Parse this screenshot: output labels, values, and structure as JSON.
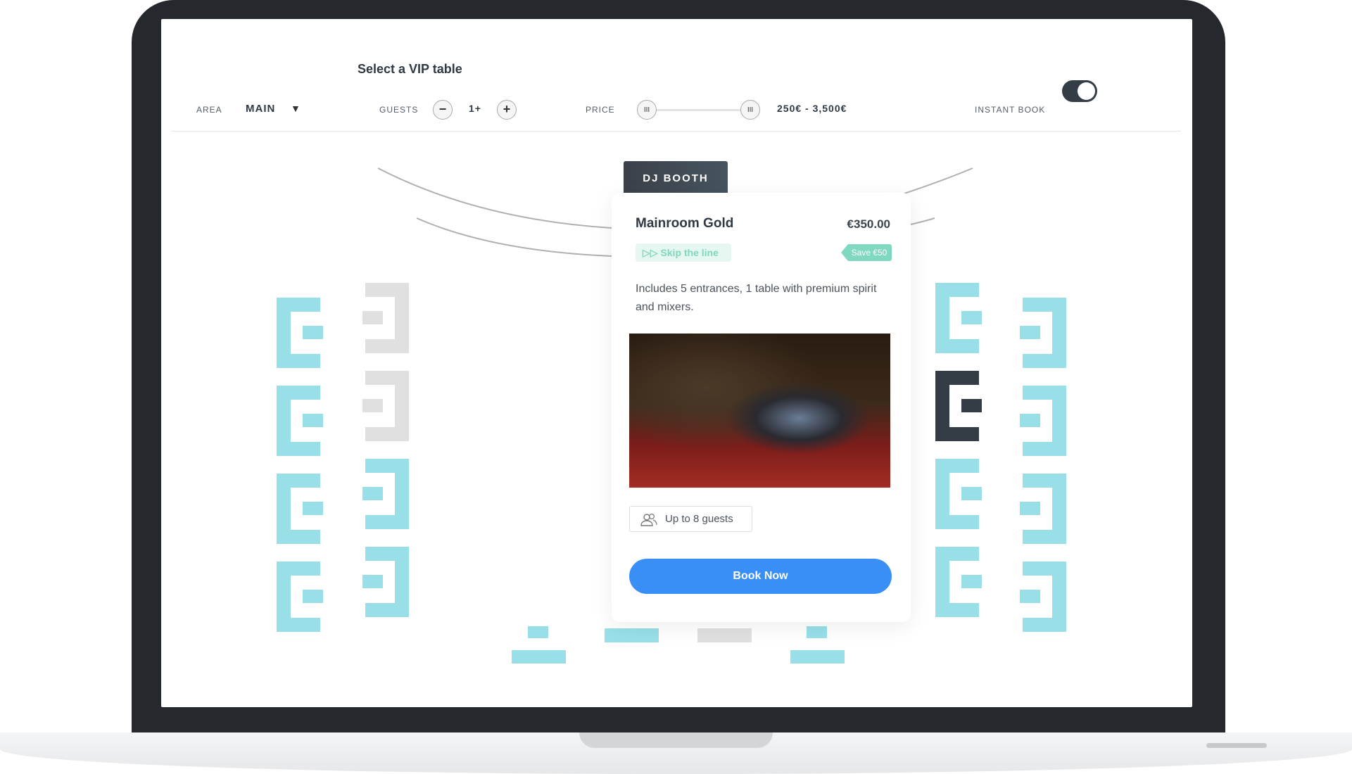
{
  "header": {
    "title": "Select a VIP table"
  },
  "filters": {
    "area_label": "AREA",
    "area_value": "MAIN",
    "guests_label": "GUESTS",
    "guests_value": "1+",
    "minus": "−",
    "plus": "+",
    "price_label": "PRICE",
    "price_range": "250€ - 3,500€",
    "price_min_handle": "III",
    "price_max_handle": "III",
    "instant_book_label": "INSTANT BOOK",
    "instant_book_on": true
  },
  "map": {
    "stage_label": "DJ BOOTH",
    "colors": {
      "available": "#98dfe8",
      "unavailable": "#e0e0e0",
      "selected": "#343d45"
    }
  },
  "card": {
    "name": "Mainroom Gold",
    "price": "€350.00",
    "skip_badge": "Skip the line",
    "save_badge": "Save €50",
    "description": "Includes 5 entrances, 1 table with premium spirit and mixers.",
    "capacity": "Up to 8 guests",
    "book_label": "Book Now",
    "accent": "#3a8ff7"
  }
}
